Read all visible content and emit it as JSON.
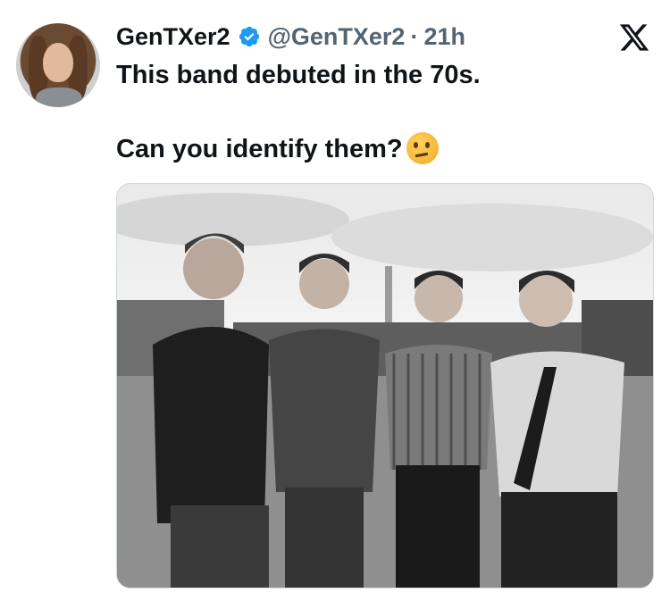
{
  "tweet": {
    "author": {
      "display_name": "GenTXer2",
      "handle": "@GenTXer2",
      "separator": "·",
      "time": "21h",
      "verified": true
    },
    "text_line1": "This band debuted in the 70s.",
    "text_line2": "Can you identify them?",
    "emoji": "thinking-face",
    "media": {
      "type": "photo",
      "description_icon": "band-photo"
    }
  },
  "colors": {
    "verified_blue": "#1d9bf0",
    "secondary_text": "#536471",
    "primary_text": "#0f1419",
    "border": "#cfd9de"
  }
}
